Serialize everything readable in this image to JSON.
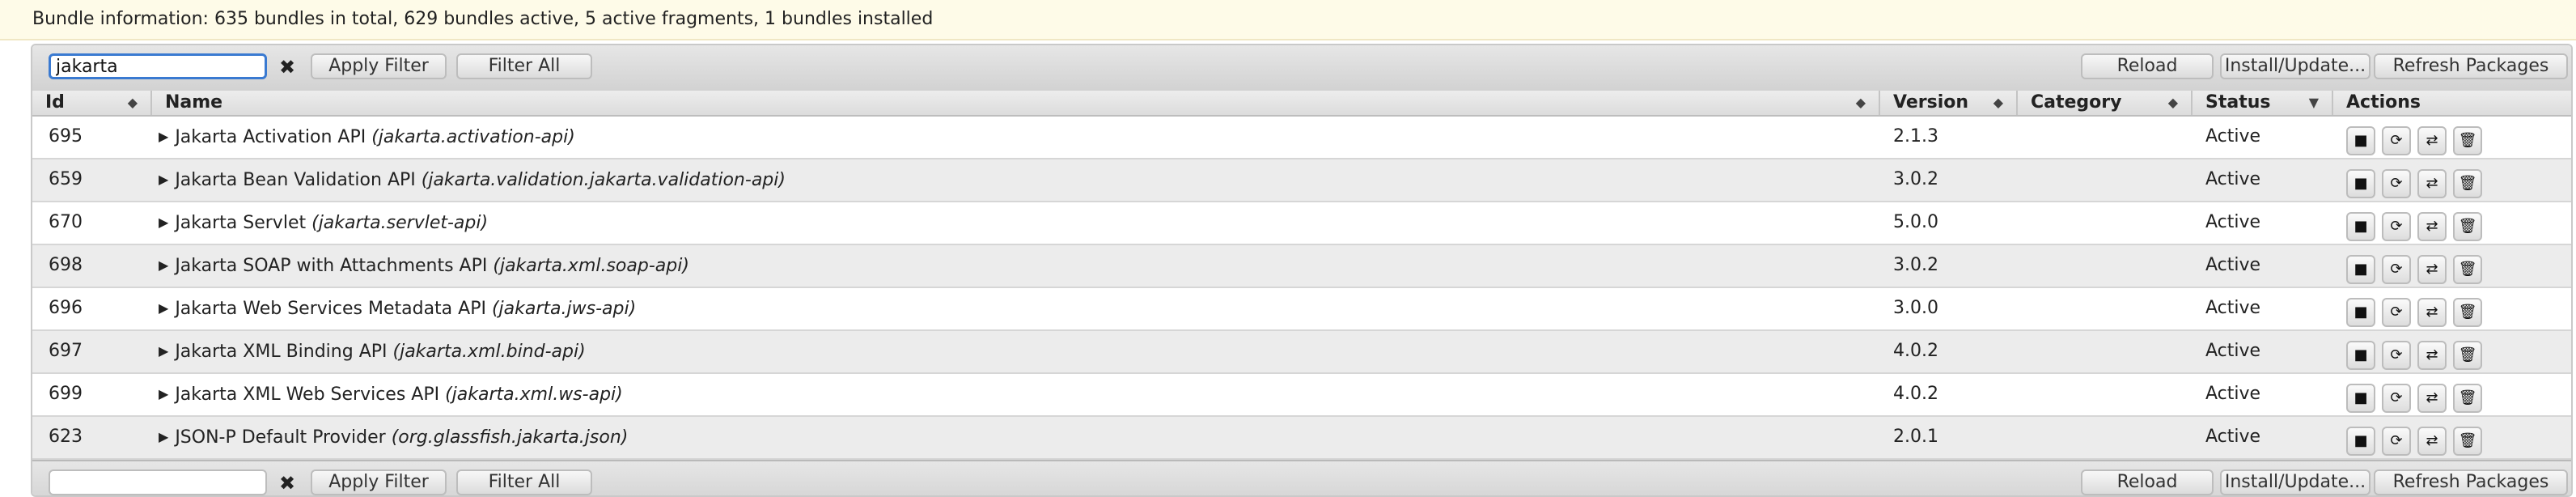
{
  "status_bar": {
    "text": "Bundle information: 635 bundles in total, 629 bundles active, 5 active fragments, 1 bundles installed"
  },
  "toolbar": {
    "filter_value": "jakarta",
    "clear_symbol": "✖",
    "apply_filter_label": "Apply Filter",
    "filter_all_label": "Filter All",
    "reload_label": "Reload",
    "install_update_label": "Install/Update...",
    "refresh_packages_label": "Refresh Packages"
  },
  "table": {
    "columns": {
      "id": "Id",
      "name": "Name",
      "version": "Version",
      "category": "Category",
      "status": "Status",
      "actions": "Actions"
    },
    "rows": [
      {
        "id": "695",
        "name": "Jakarta Activation API",
        "symbolic": "(jakarta.activation-api)",
        "version": "2.1.3",
        "category": "",
        "status": "Active"
      },
      {
        "id": "659",
        "name": "Jakarta Bean Validation API",
        "symbolic": "(jakarta.validation.jakarta.validation-api)",
        "version": "3.0.2",
        "category": "",
        "status": "Active"
      },
      {
        "id": "670",
        "name": "Jakarta Servlet",
        "symbolic": "(jakarta.servlet-api)",
        "version": "5.0.0",
        "category": "",
        "status": "Active"
      },
      {
        "id": "698",
        "name": "Jakarta SOAP with Attachments API",
        "symbolic": "(jakarta.xml.soap-api)",
        "version": "3.0.2",
        "category": "",
        "status": "Active"
      },
      {
        "id": "696",
        "name": "Jakarta Web Services Metadata API",
        "symbolic": "(jakarta.jws-api)",
        "version": "3.0.0",
        "category": "",
        "status": "Active"
      },
      {
        "id": "697",
        "name": "Jakarta XML Binding API",
        "symbolic": "(jakarta.xml.bind-api)",
        "version": "4.0.2",
        "category": "",
        "status": "Active"
      },
      {
        "id": "699",
        "name": "Jakarta XML Web Services API",
        "symbolic": "(jakarta.xml.ws-api)",
        "version": "4.0.2",
        "category": "",
        "status": "Active"
      },
      {
        "id": "623",
        "name": "JSON-P Default Provider",
        "symbolic": "(org.glassfish.jakarta.json)",
        "version": "2.0.1",
        "category": "",
        "status": "Active"
      }
    ],
    "action_icons": {
      "stop": "■",
      "refresh": "⟳",
      "update": "⇄",
      "uninstall": "🗑"
    }
  },
  "bottom_toolbar": {
    "clear_symbol": "✖",
    "apply_filter_label": "Apply Filter",
    "filter_all_label": "Filter All",
    "reload_label": "Reload",
    "install_update_label": "Install/Update...",
    "refresh_packages_label": "Refresh Packages"
  }
}
